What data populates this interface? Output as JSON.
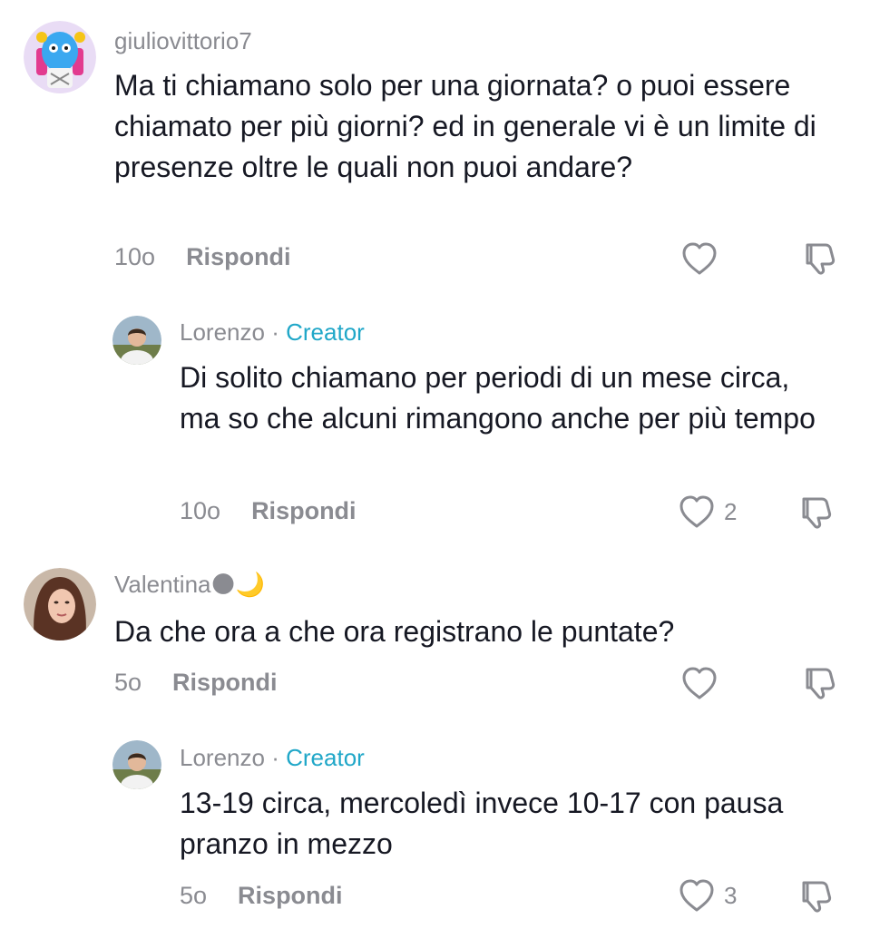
{
  "comments": [
    {
      "username": "giuliovittorio7",
      "text": "Ma ti chiamano solo per una giornata? o puoi essere chiamato per più giorni? ed in generale vi è un limite di presenze oltre le quali non puoi andare?",
      "time": "10o",
      "reply_label": "Rispondi",
      "likes": ""
    },
    {
      "username": "Lorenzo",
      "separator": "·",
      "creator_label": "Creator",
      "text": "Di solito chiamano per periodi di un mese circa, ma so che alcuni rimangono anche per più tempo",
      "time": "10o",
      "reply_label": "Rispondi",
      "likes": "2"
    },
    {
      "username": "Valentina🌑🌙",
      "text": "Da che ora a che ora registrano le puntate?",
      "time": "5o",
      "reply_label": "Rispondi",
      "likes": ""
    },
    {
      "username": "Lorenzo",
      "separator": "·",
      "creator_label": "Creator",
      "text": "13-19 circa, mercoledì invece 10-17 con pausa pranzo in mezzo",
      "time": "5o",
      "reply_label": "Rispondi",
      "likes": "3"
    }
  ],
  "icons": {
    "like": "heart-outline-icon",
    "dislike": "thumbs-down-outline-icon"
  },
  "colors": {
    "creator": "#20a7c8",
    "secondary_text": "#8a8b91",
    "primary_text": "#161823"
  }
}
